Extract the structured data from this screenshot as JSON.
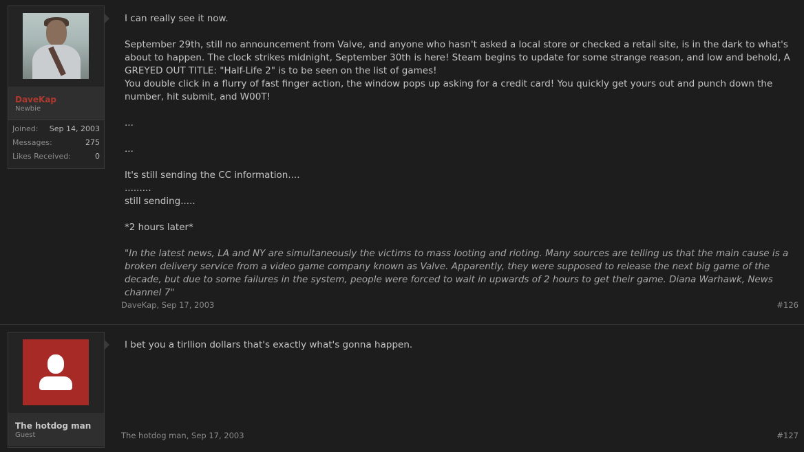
{
  "posts": [
    {
      "username": "DaveKap",
      "user_title": "Newbie",
      "avatar": "user-photo",
      "stats": [
        {
          "label": "Joined:",
          "value": "Sep 14, 2003"
        },
        {
          "label": "Messages:",
          "value": "275"
        },
        {
          "label": "Likes Received:",
          "value": "0"
        }
      ],
      "message": {
        "p1": "I can really see it now.",
        "p2": "September 29th, still no announcement from Valve, and anyone who hasn't asked a local store or checked a retail site, is in the dark to what's about to happen. The clock strikes midnight, September 30th is here! Steam begins to update for some strange reason, and low and behold, A GREYED OUT TITLE: \"Half-Life 2\" is to be seen on the list of games!",
        "p3": "You double click in a flurry of fast finger action, the window pops up asking for a credit card! You quickly get yours out and punch down the number, hit submit, and W00T!",
        "p4": "...",
        "p5": "...",
        "p6": "It's still sending the CC information....",
        "p7": ".........",
        "p8": "still sending.....",
        "p9": "*2 hours later*",
        "quote": "\"In the latest news, LA and NY are simultaneously the victims to mass looting and rioting. Many sources are telling us that the main cause is a broken delivery service from a video game company known as Valve. Apparently, they were supposed to release the next big game of the decade, but due to some failures in the system, people were forced to wait in upwards of 2 hours to get their game. Diana Warhawk, News channel 7\""
      },
      "meta": "DaveKap, Sep 17, 2003",
      "post_number": "#126"
    },
    {
      "username": "The hotdog man",
      "user_title": "Guest",
      "avatar": "default-user-icon",
      "message": {
        "p1": "I bet you a tirllion dollars that's exactly what's gonna happen."
      },
      "meta": "The hotdog man, Sep 17, 2003",
      "post_number": "#127"
    }
  ],
  "colors": {
    "background": "#1d1d1d",
    "username_staff": "#b0392f",
    "default_avatar": "#a82a26"
  }
}
